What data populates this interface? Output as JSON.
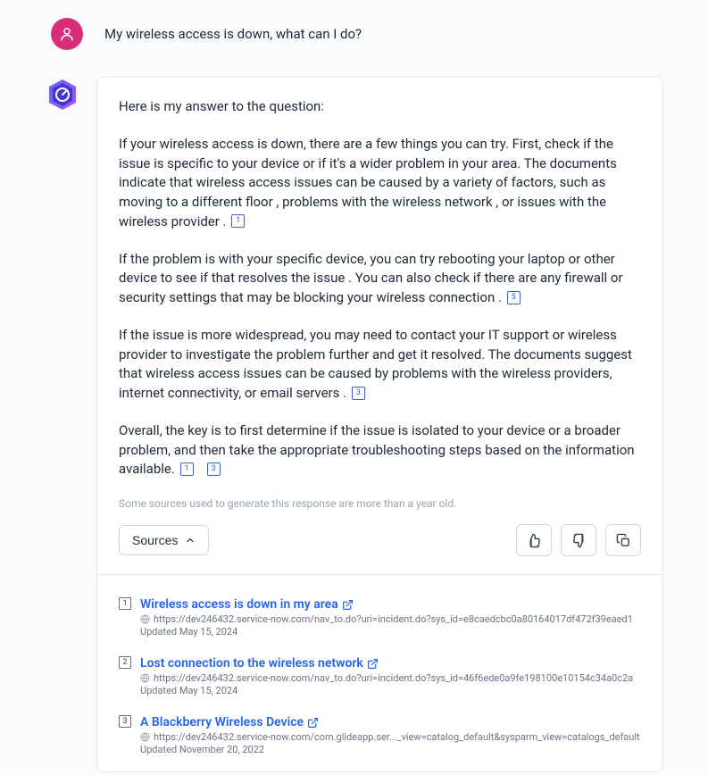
{
  "user": {
    "question": "My wireless access is down, what can I do?"
  },
  "answer": {
    "intro": "Here is my answer to the question:",
    "para1_before_cite1": "If your wireless access is down, there are a few things you can try. First, check if the issue is specific to your device or if it's a wider problem in your area. The documents indicate that wireless access issues can be caused by a variety of factors, such as moving to a different floor , problems with the wireless network , or issues with the wireless provider . ",
    "cite1": "1",
    "para2_before_cite5": "If the problem is with your specific device, you can try rebooting your laptop or other device to see if that resolves the issue .   You can also check if there are any firewall or security settings that may be blocking your wireless connection . ",
    "cite5": "5",
    "para3_before_cite3": "If the issue is more widespread, you may need to contact your IT support or wireless provider to investigate the problem further and get it resolved. The documents suggest that wireless access issues can be caused by problems with the wireless providers, internet connectivity, or email servers . ",
    "cite3": "3",
    "para4_before_cites": "Overall, the key is to first determine if the issue is isolated to your device or a broader problem, and then take the appropriate troubleshooting steps based on the information available. ",
    "cite4a": "1",
    "cite4b": "3",
    "disclaimer": "Some sources used to generate this response are more than a year old."
  },
  "actions": {
    "sources_label": "Sources"
  },
  "sources": [
    {
      "num": "1",
      "title": "Wireless access is down in my area",
      "url": "https://dev246432.service-now.com/nav_to.do?uri=incident.do?sys_id=e8caedcbc0a80164017df472f39eaed1",
      "updated": "Updated May 15, 2024"
    },
    {
      "num": "2",
      "title": "Lost connection to the wireless network",
      "url": "https://dev246432.service-now.com/nav_to.do?uri=incident.do?sys_id=46f6ede0a9fe198100e10154c34a0c2a",
      "updated": "Updated May 15, 2024"
    },
    {
      "num": "3",
      "title": "A Blackberry Wireless Device",
      "url": "https://dev246432.service-now.com/com.glideapp.ser..._view=catalog_default&sysparm_view=catalogs_default",
      "updated": "Updated November 20, 2022"
    }
  ]
}
